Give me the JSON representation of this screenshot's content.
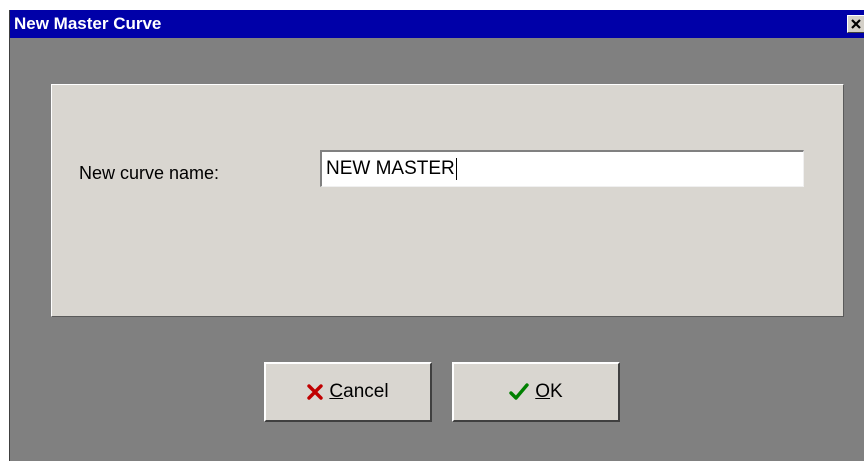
{
  "window": {
    "title": "New Master Curve"
  },
  "form": {
    "label": "New curve name:",
    "value": "NEW MASTER"
  },
  "buttons": {
    "cancel": {
      "accel": "C",
      "rest": "ancel",
      "icon": "x-icon",
      "icon_color": "#c00000"
    },
    "ok": {
      "accel": "O",
      "rest": "K",
      "icon": "checkmark-icon",
      "icon_color": "#008000"
    }
  },
  "colors": {
    "titlebar": "#0000a8",
    "background": "#808080",
    "panel": "#d9d6d0"
  }
}
